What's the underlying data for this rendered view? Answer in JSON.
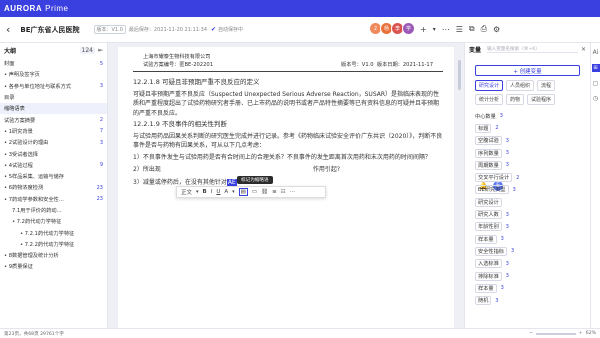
{
  "app": {
    "logo": "AURORA",
    "prime": "Prime",
    "avatar_initial": "E"
  },
  "topbar_icons": [
    "grid-icon",
    "bell-icon"
  ],
  "doc": {
    "title": "BE广东省人民医院",
    "version_tag": "版本：V1.0",
    "saved_time": "最后保存：2021-11-20 21:11:34",
    "auto_save": "自动保存中"
  },
  "collaborators": [
    {
      "label": "2",
      "color": "#f08a5d"
    },
    {
      "label": "杨",
      "color": "#e8703a"
    },
    {
      "label": "李",
      "color": "#d9534f"
    },
    {
      "label": "学",
      "color": "#9b59b6"
    }
  ],
  "outline": {
    "title": "大纲",
    "count": "124",
    "items": [
      {
        "label": "封面",
        "n": "5",
        "indent": 0
      },
      {
        "label": "• 声明及签字页",
        "n": "",
        "indent": 0
      },
      {
        "label": "• 各参与单位地址与联系方式",
        "n": "3",
        "indent": 0
      },
      {
        "label": "目录",
        "n": "",
        "indent": 0
      },
      {
        "label": "缩略语表",
        "n": "",
        "indent": 0,
        "active": true
      },
      {
        "label": "试验方案摘要",
        "n": "2",
        "indent": 0
      },
      {
        "label": "• 1研究背景",
        "n": "7",
        "indent": 0
      },
      {
        "label": "• 2试验设计的理由",
        "n": "3",
        "indent": 0
      },
      {
        "label": "• 3受试者选择",
        "n": "",
        "indent": 0
      },
      {
        "label": "• 4试验过程",
        "n": "9",
        "indent": 0
      },
      {
        "label": "• 5样品采集、运输与储存",
        "n": "",
        "indent": 0
      },
      {
        "label": "• 6药物浓度检测",
        "n": "23",
        "indent": 0
      },
      {
        "label": "• 7药动学参数和安全性…",
        "n": "23",
        "indent": 0
      },
      {
        "label": "7.1用于评价的药动…",
        "n": "",
        "indent": 1
      },
      {
        "label": "• 7.2药代动力学特征",
        "n": "",
        "indent": 1
      },
      {
        "label": "• 7.2.1药代动力学特征",
        "n": "",
        "indent": 2
      },
      {
        "label": "• 7.2.2药代动力学特征",
        "n": "",
        "indent": 2
      },
      {
        "label": "• 8数据管理及统计分析",
        "n": "",
        "indent": 0
      },
      {
        "label": "• 9质量保证",
        "n": "",
        "indent": 0
      }
    ]
  },
  "page": {
    "company": "上海市耀泰生物科技有限公司",
    "protocol": "试验方案编号：匿BE-202201",
    "version": "版本号：V1.0",
    "date": "版本日期：2021-11-17",
    "p1": "12.2.1.8 可疑且非预期严重不良反应的定义",
    "p2": "可疑且非预期严重不良反应（Suspected Unexpected Serious Adverse Reaction，SUSAR）是指临床表现的性质和严重程度超出了试验药物研究者手册、已上市药品的说明书或者产品特性摘要等已有资料信息的可疑并且非预期的严重不良反应。",
    "p3": "12.2.1.9 不良事件的相关性判断",
    "p4": "与试验用药品因果关系判断的研究医生完成并进行记录。参考《药物临床试验安全评价广东共识（2020）》，判断不良事件是否与药物有因果关系，可从以下几点考虑：",
    "p5": "1）不良事件发生与试验用药是否有合时间上的合理关系？不良事件的发生距离首次用药和末次用药的时间间隔？",
    "p6a": "2）所出现",
    "p6b": "作用引起?",
    "p7": "3）减量或停药后，在没有其他针对",
    "p7hl": "AE"
  },
  "format_toolbar": {
    "style": "正文",
    "tooltip": "标记为缩略语"
  },
  "variables": {
    "title": "变量",
    "search_placeholder": "输入变量名搜索（⌘+K）",
    "create": "+ 创建变量",
    "categories": [
      "研究设计",
      "人员组织",
      "流程",
      "统计分析",
      "药物",
      "试验程序"
    ],
    "items": [
      {
        "label": "中心数量",
        "n": "3",
        "boxed": false
      },
      {
        "label": "标题",
        "n": "2",
        "boxed": true
      },
      {
        "label": "空腹试验",
        "n": "3",
        "boxed": true
      },
      {
        "label": "序列数量",
        "n": "3",
        "boxed": true
      },
      {
        "label": "周期数量",
        "n": "3",
        "boxed": true
      },
      {
        "label": "交叉平行设计",
        "n": "2",
        "boxed": true
      },
      {
        "label": "BE研究类型",
        "n": "3",
        "boxed": true
      },
      {
        "label": "研究设计",
        "n": "",
        "boxed": true
      },
      {
        "label": "研究人数",
        "n": "3",
        "boxed": true
      },
      {
        "label": "年龄性别",
        "n": "3",
        "boxed": true
      },
      {
        "label": "样本量",
        "n": "3",
        "boxed": true
      },
      {
        "label": "安全性指标",
        "n": "3",
        "boxed": true
      },
      {
        "label": "入选标准",
        "n": "3",
        "boxed": true
      },
      {
        "label": "排除标准",
        "n": "3",
        "boxed": true
      },
      {
        "label": "样本量",
        "n": "3",
        "boxed": true
      },
      {
        "label": "随机",
        "n": "3",
        "boxed": true
      }
    ]
  },
  "status": {
    "text": "第23页，共68页  29761个字",
    "zoom": "62%"
  }
}
